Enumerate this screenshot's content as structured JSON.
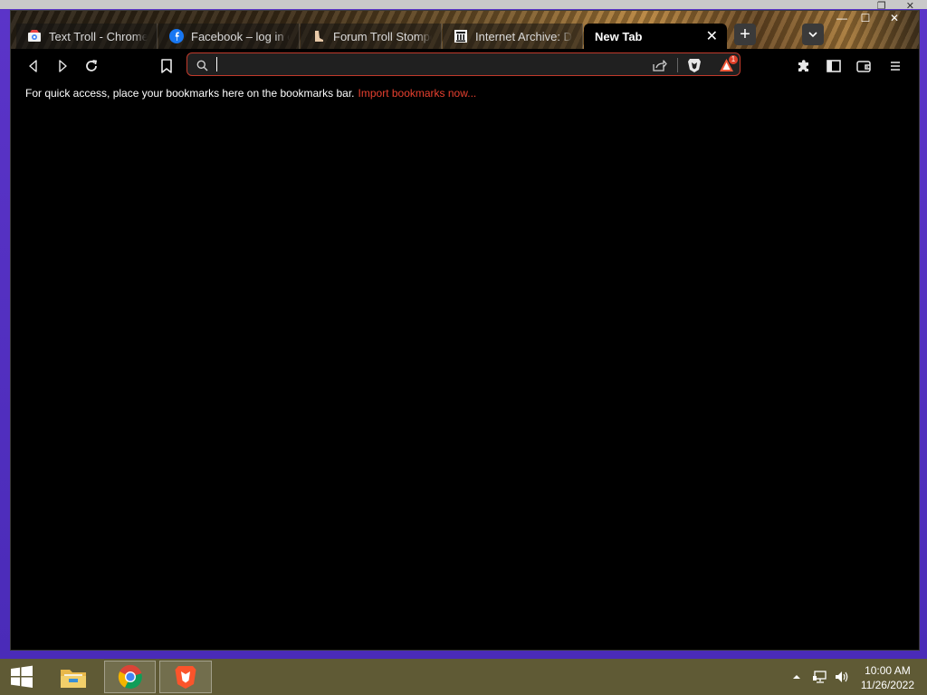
{
  "tabs": [
    {
      "label": "Text Troll - Chrome Web Store",
      "favicon": "chrome-web-store-icon",
      "active": false
    },
    {
      "label": "Facebook – log in or sign up",
      "favicon": "facebook-icon",
      "active": false
    },
    {
      "label": "Forum Troll Stomper Shop",
      "favicon": "troll-stomper-icon",
      "active": false
    },
    {
      "label": "Internet Archive: Digital Library",
      "favicon": "internet-archive-icon",
      "active": false
    },
    {
      "label": "New Tab",
      "favicon": "",
      "active": true
    }
  ],
  "tab_close_glyph": "✕",
  "new_tab_glyph": "+",
  "window_controls": {
    "minimize": "—",
    "maximize": "☐",
    "close": "✕"
  },
  "omnibox": {
    "value": "",
    "placeholder": ""
  },
  "rewards_badge": "1",
  "bookmarks_bar": {
    "message": "For quick access, place your bookmarks here on the bookmarks bar.",
    "link": "Import bookmarks now..."
  },
  "taskbar": {
    "apps": [
      "start-icon",
      "file-explorer-icon",
      "chrome-icon",
      "brave-icon"
    ],
    "time": "10:00 AM",
    "date": "11/26/2022"
  },
  "colors": {
    "accent": "#e8402f",
    "omnibox_border": "#c03a2b",
    "taskbar": "#5f5a35"
  }
}
